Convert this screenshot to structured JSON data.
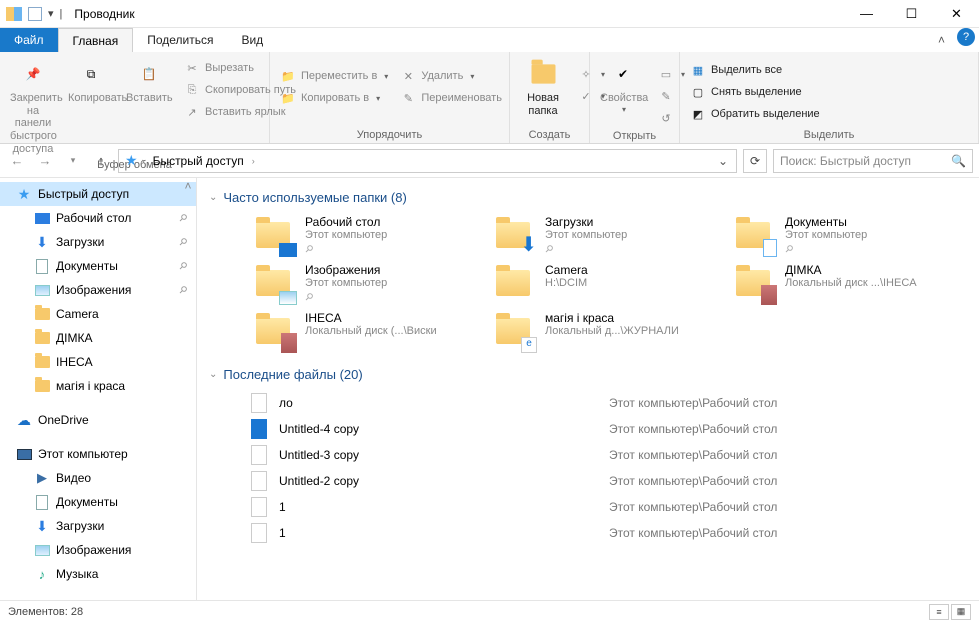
{
  "window": {
    "title": "Проводник"
  },
  "tabs": {
    "file": "Файл",
    "home": "Главная",
    "share": "Поделиться",
    "view": "Вид"
  },
  "ribbon": {
    "clipboard": {
      "label": "Буфер обмена",
      "pin": "Закрепить на панели\nбыстрого доступа",
      "copy": "Копировать",
      "paste": "Вставить",
      "cut": "Вырезать",
      "copypath": "Скопировать путь",
      "pasteshortcut": "Вставить ярлык"
    },
    "organize": {
      "label": "Упорядочить",
      "moveto": "Переместить в",
      "copyto": "Копировать в",
      "delete": "Удалить",
      "rename": "Переименовать"
    },
    "new": {
      "label": "Создать",
      "newfolder": "Новая\nпапка"
    },
    "open": {
      "label": "Открыть",
      "props": "Свойства"
    },
    "select": {
      "label": "Выделить",
      "all": "Выделить все",
      "none": "Снять выделение",
      "invert": "Обратить выделение"
    }
  },
  "address": {
    "crumb1": "Быстрый доступ"
  },
  "search": {
    "placeholder": "Поиск: Быстрый доступ"
  },
  "navpane": {
    "quick": "Быстрый доступ",
    "items": [
      {
        "label": "Рабочий стол"
      },
      {
        "label": "Загрузки"
      },
      {
        "label": "Документы"
      },
      {
        "label": "Изображения"
      },
      {
        "label": "Camera"
      },
      {
        "label": "ДІМКА"
      },
      {
        "label": "IHECA"
      },
      {
        "label": "магія і краса"
      }
    ],
    "onedrive": "OneDrive",
    "thispc": "Этот компьютер",
    "pcitems": [
      {
        "label": "Видео"
      },
      {
        "label": "Документы"
      },
      {
        "label": "Загрузки"
      },
      {
        "label": "Изображения"
      },
      {
        "label": "Музыка"
      }
    ]
  },
  "content": {
    "freq_header": "Часто используемые папки (8)",
    "freq": [
      {
        "name": "Рабочий стол",
        "path": "Этот компьютер",
        "pin": true,
        "overlay": "desktop"
      },
      {
        "name": "Загрузки",
        "path": "Этот компьютер",
        "pin": true,
        "overlay": "down"
      },
      {
        "name": "Документы",
        "path": "Этот компьютер",
        "pin": true,
        "overlay": "doc"
      },
      {
        "name": "Изображения",
        "path": "Этот компьютер",
        "pin": true,
        "overlay": "pic"
      },
      {
        "name": "Camera",
        "path": "H:\\DCIM",
        "pin": false
      },
      {
        "name": "ДІМКА",
        "path": "Локальный диск ...\\IHECA",
        "pin": false,
        "overlay": "thumb"
      },
      {
        "name": "IHECA",
        "path": "Локальный диск (...\\Виски",
        "pin": false,
        "overlay": "thumb2"
      },
      {
        "name": "магія і краса",
        "path": "Локальный д...\\ЖУРНАЛИ",
        "pin": false,
        "overlay": "edge"
      }
    ],
    "recent_header": "Последние файлы (20)",
    "recent": [
      {
        "name": "ло",
        "loc": "Этот компьютер\\Рабочий стол",
        "kind": "txt"
      },
      {
        "name": "Untitled-4 copy",
        "loc": "Этот компьютер\\Рабочий стол",
        "kind": "blue"
      },
      {
        "name": "Untitled-3 copy",
        "loc": "Этот компьютер\\Рабочий стол",
        "kind": "txt"
      },
      {
        "name": "Untitled-2 copy",
        "loc": "Этот компьютер\\Рабочий стол",
        "kind": "txt"
      },
      {
        "name": "1",
        "loc": "Этот компьютер\\Рабочий стол",
        "kind": "txt"
      },
      {
        "name": "1",
        "loc": "Этот компьютер\\Рабочий стол",
        "kind": "txt"
      }
    ]
  },
  "status": {
    "text": "Элементов: 28"
  }
}
